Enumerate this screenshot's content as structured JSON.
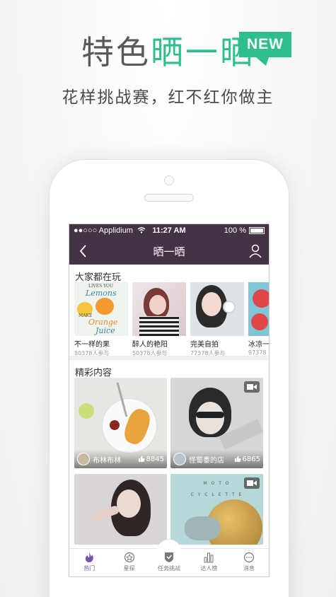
{
  "promo": {
    "headline_gray": "特色",
    "headline_green": "晒一晒",
    "badge": "NEW",
    "subtitle": "花样挑战赛，红不红你做主"
  },
  "statusbar": {
    "carrier": "●●○○○ Applidium",
    "time": "11:27 AM",
    "battery": "100 %"
  },
  "navbar": {
    "title": "晒一晒",
    "back_icon": "chevron-left-icon",
    "user_icon": "user-icon"
  },
  "hot_section": {
    "title": "大家都在玩",
    "items": [
      {
        "name": "不一样的果",
        "count": "80378人参与",
        "thumb_text_1": "LIVES YOU",
        "thumb_text_2": "Lemons",
        "thumb_text_3": "MAKE",
        "thumb_text_4": "Orange",
        "thumb_text_5": "Juice"
      },
      {
        "name": "醉人的艳阳",
        "count": "50378人参与"
      },
      {
        "name": "完美自拍",
        "count": "77378人参与"
      },
      {
        "name": "冰凉一",
        "count": "97378"
      }
    ]
  },
  "content_section": {
    "title": "精彩内容",
    "tiles": [
      {
        "author": "布林布林",
        "likes": "8845",
        "video": false
      },
      {
        "author": "怪蜀黍的店",
        "likes": "6865",
        "video": true
      },
      {
        "author": "",
        "likes": "",
        "video": false
      },
      {
        "author": "",
        "likes": "",
        "video": true,
        "overlay_text_1": "M O T O",
        "overlay_text_2": "C Y C L E T T E"
      }
    ]
  },
  "tabbar": {
    "tabs": [
      {
        "label": "热门",
        "icon": "flame-icon",
        "active": true
      },
      {
        "label": "星探",
        "icon": "star-compass-icon",
        "active": false
      },
      {
        "label": "任务挑战",
        "icon": "task-shield-icon",
        "active": false
      },
      {
        "label": "达人榜",
        "icon": "bar-chart-icon",
        "active": false
      },
      {
        "label": "消息",
        "icon": "message-icon",
        "active": false
      }
    ]
  },
  "colors": {
    "accent_green": "#2fbf8e",
    "nav_purple": "#433345",
    "tab_active": "#7b4fae"
  }
}
